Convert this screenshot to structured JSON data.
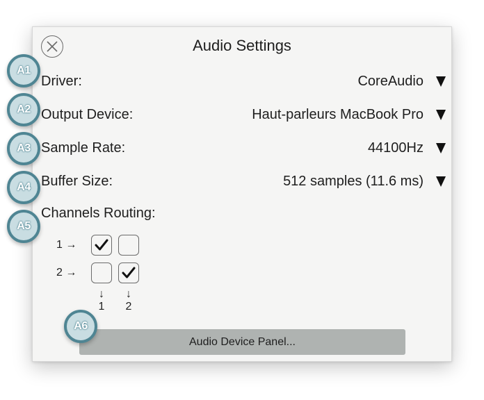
{
  "dialog": {
    "title": "Audio Settings",
    "close_icon": "close-circle-icon"
  },
  "settings": [
    {
      "label": "Driver:",
      "value": "CoreAudio"
    },
    {
      "label": "Output Device:",
      "value": "Haut-parleurs MacBook Pro"
    },
    {
      "label": "Sample Rate:",
      "value": "44100Hz"
    },
    {
      "label": "Buffer Size:",
      "value": "512 samples (11.6 ms)"
    }
  ],
  "routing": {
    "label": "Channels Routing:",
    "inputs": [
      "1 →",
      "2 →"
    ],
    "outputs": [
      "↓\n1",
      "↓\n2"
    ],
    "output_arrow": "↓",
    "output_numbers": [
      "1",
      "2"
    ],
    "matrix": [
      [
        true,
        false
      ],
      [
        false,
        true
      ]
    ]
  },
  "panel_button": {
    "label": "Audio Device Panel..."
  },
  "annotations": [
    "A1",
    "A2",
    "A3",
    "A4",
    "A5",
    "A6"
  ],
  "colors": {
    "badge_fill": "#c9dde2",
    "badge_ring": "#4f8593",
    "panel_button": "#afb3b1",
    "dialog_bg": "#f5f5f4"
  }
}
